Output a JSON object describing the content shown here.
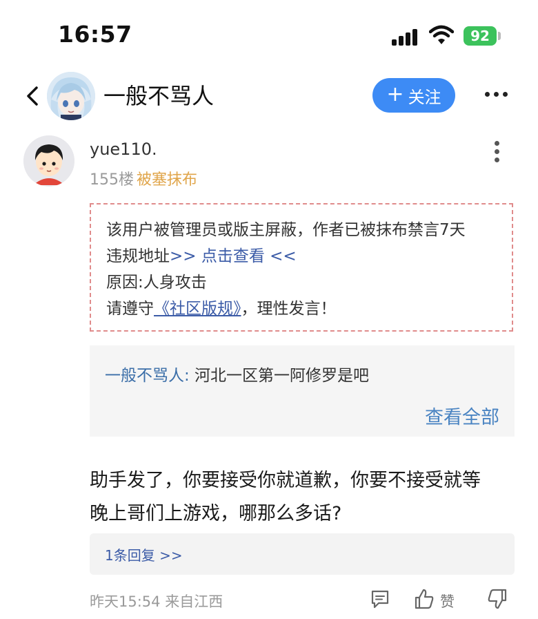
{
  "status_bar": {
    "time": "16:57",
    "battery": "92",
    "icons": [
      "signal-icon",
      "wifi-icon",
      "battery-icon"
    ]
  },
  "header": {
    "title": "一般不骂人",
    "follow_plus": "+",
    "follow_label": "关注",
    "icons": [
      "back-icon",
      "more-icon"
    ]
  },
  "post": {
    "username": "yue110.",
    "floor": "155楼",
    "tag": "被塞抹布",
    "tag_color": "#e0a54a",
    "notice": {
      "line1": "该用户被管理员或版主屏蔽，作者已被抹布禁言7天",
      "line2_prefix": "违规地址",
      "line2_link": ">> 点击查看 <<",
      "line3": "原因:人身攻击",
      "line4_prefix": "请遵守",
      "line4_link": "《社区版规》",
      "line4_suffix": "，理性发言！"
    },
    "quote": {
      "author": "一般不骂人:",
      "text": " 河北一区第一阿修罗是吧",
      "more": "查看全部"
    },
    "body_line1": "助手发了，你要接受你就道歉，你要不接受就等",
    "body_line2": "晚上哥们上游戏，哪那么多话?",
    "reply_count": "1条回复 >>",
    "meta": "昨天15:54 来自江西",
    "like_label": "赞"
  },
  "colors": {
    "accent": "#3d8bf5",
    "link": "#3b5ba7",
    "notice_border": "#e08b8b",
    "battery": "#3cc25c"
  }
}
